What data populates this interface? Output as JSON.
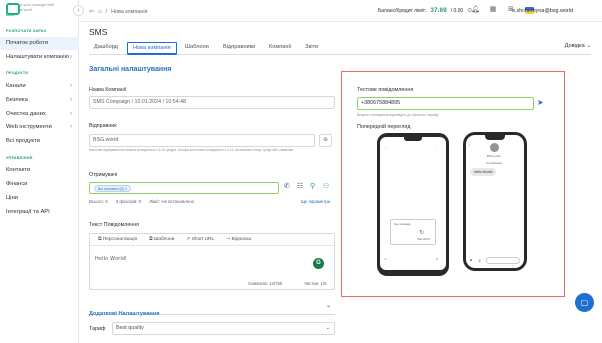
{
  "brand": {
    "name": "BSG",
    "tagline": "Let your message stuff the world"
  },
  "sidebar": {
    "section1": "РОЗПОЧАТИ ЗАРАЗ",
    "top_items": [
      {
        "label": "Початок роботи",
        "chev": ""
      },
      {
        "label": "Налаштувати компанію",
        "chev": "›"
      }
    ],
    "section2": "ПРОДУКТИ",
    "products": [
      {
        "label": "Канали",
        "chev": "›"
      },
      {
        "label": "Безпека",
        "chev": "›"
      },
      {
        "label": "Очистка даних",
        "chev": "›"
      },
      {
        "label": "Web інструменти",
        "chev": "›"
      },
      {
        "label": "Всі продукти",
        "chev": ""
      }
    ],
    "section3": "УПРАВЛІННЯ",
    "manage": [
      {
        "label": "Контакти"
      },
      {
        "label": "Фінанси"
      },
      {
        "label": "Ціни"
      },
      {
        "label": "Інтеграції та API"
      }
    ]
  },
  "topbar": {
    "breadcrumb": "Нова компанія",
    "balance_label": "Баланс/Кредит ліміт:",
    "balance_amount": "37.69",
    "balance_rest": "/ 0.00",
    "currency_icon": "coin-icon",
    "user": "o.shcherbyna@bsg.world"
  },
  "page": {
    "title": "SMS",
    "tabs": [
      "Дашборд",
      "Нова компанія",
      "Шаблони",
      "Відправники",
      "Компанії",
      "Звіти"
    ],
    "active_tab": 1,
    "help": "Довідка"
  },
  "form": {
    "section_title": "Загальні налаштування",
    "name_label": "Назва Компанії",
    "name_value": "SMS Compaign / 10.01.2024 / 10:54:48",
    "sender_label": "Відправник",
    "sender_value": "BSG.world",
    "sender_hint": "Числове відправлення можна складатися з 3-15 цифри. Альфа-ім'я може складатися з 3-11 латинських літер, цифр або символів",
    "recipients_label": "Отримувачі",
    "recipient_chip": "Всі контакти (5)",
    "stats": [
      "Всього: 5",
      "3 фільтрів: 0",
      "Ліміт: Не встановлено"
    ],
    "more_link": "Ще параметри",
    "text_label": "Текст Повідомлення",
    "editor_tools": [
      "Персоналізація",
      "Шаблони",
      "Short URL",
      "Відписка"
    ],
    "editor_text": "Hello World!",
    "chars": "Символів: 13/765",
    "parts": "Частин: 1/5",
    "advanced": "Додаткові Налаштування",
    "tariff_label": "Тариф",
    "tariff_value": "Best quality"
  },
  "test": {
    "title": "Тестове повідомлення",
    "phone_value": "+380675884895",
    "hint": "Вкажіть отримувача відповідно до обраного тарифу",
    "preview_label": "Попередній перегляд",
    "preview_msg": "Hello World!",
    "sender_name": "BSG.world",
    "left_screen_label": "New message",
    "right_screen_label": "Text Message"
  }
}
